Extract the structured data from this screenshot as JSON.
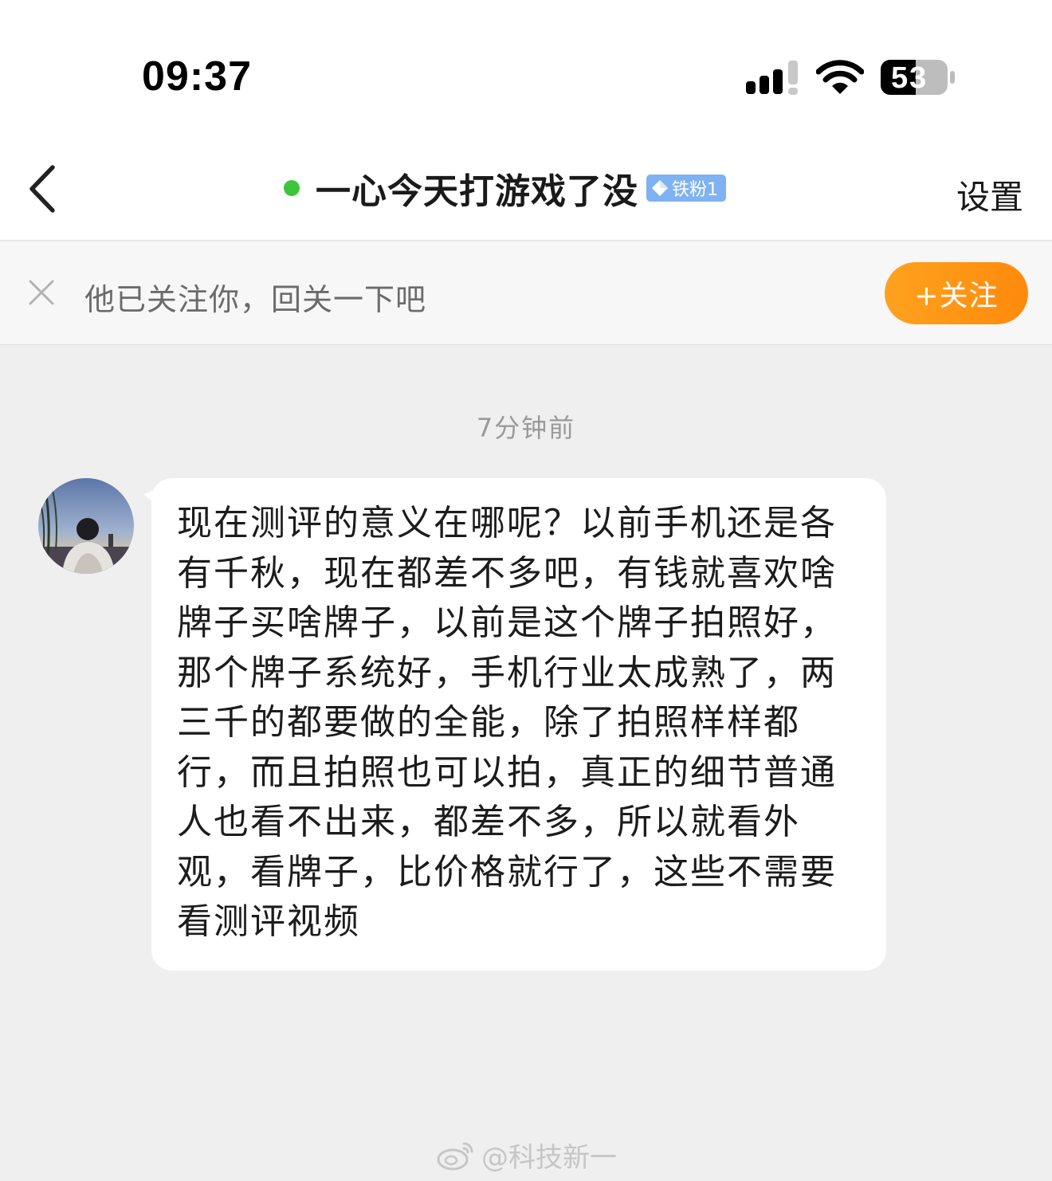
{
  "status_bar": {
    "time": "09:37",
    "battery_level": "53",
    "icons": [
      "cellular-signal-icon",
      "wifi-icon",
      "battery-icon"
    ]
  },
  "nav": {
    "back_icon": "chevron-left-icon",
    "online_status_color": "#3ec63a",
    "title": "一心今天打游戏了没",
    "fan_badge": "铁粉1",
    "settings_label": "设置"
  },
  "follow_banner": {
    "close_icon": "close-icon",
    "text": "他已关注你，回关一下吧",
    "button_label": "+关注",
    "button_color": "#ff9616"
  },
  "chat": {
    "timestamp": "7分钟前",
    "messages": [
      {
        "sender": "other",
        "text": "现在测评的意义在哪呢？以前手机还是各有千秋，现在都差不多吧，有钱就喜欢啥牌子买啥牌子，以前是这个牌子拍照好，那个牌子系统好，手机行业太成熟了，两三千的都要做的全能，除了拍照样样都行，而且拍照也可以拍，真正的细节普通人也看不出来，都差不多，所以就看外观，看牌子，比价格就行了，这些不需要看测评视频"
      }
    ]
  },
  "watermark": {
    "text": "@科技新一",
    "icon": "weibo-logo-icon"
  }
}
